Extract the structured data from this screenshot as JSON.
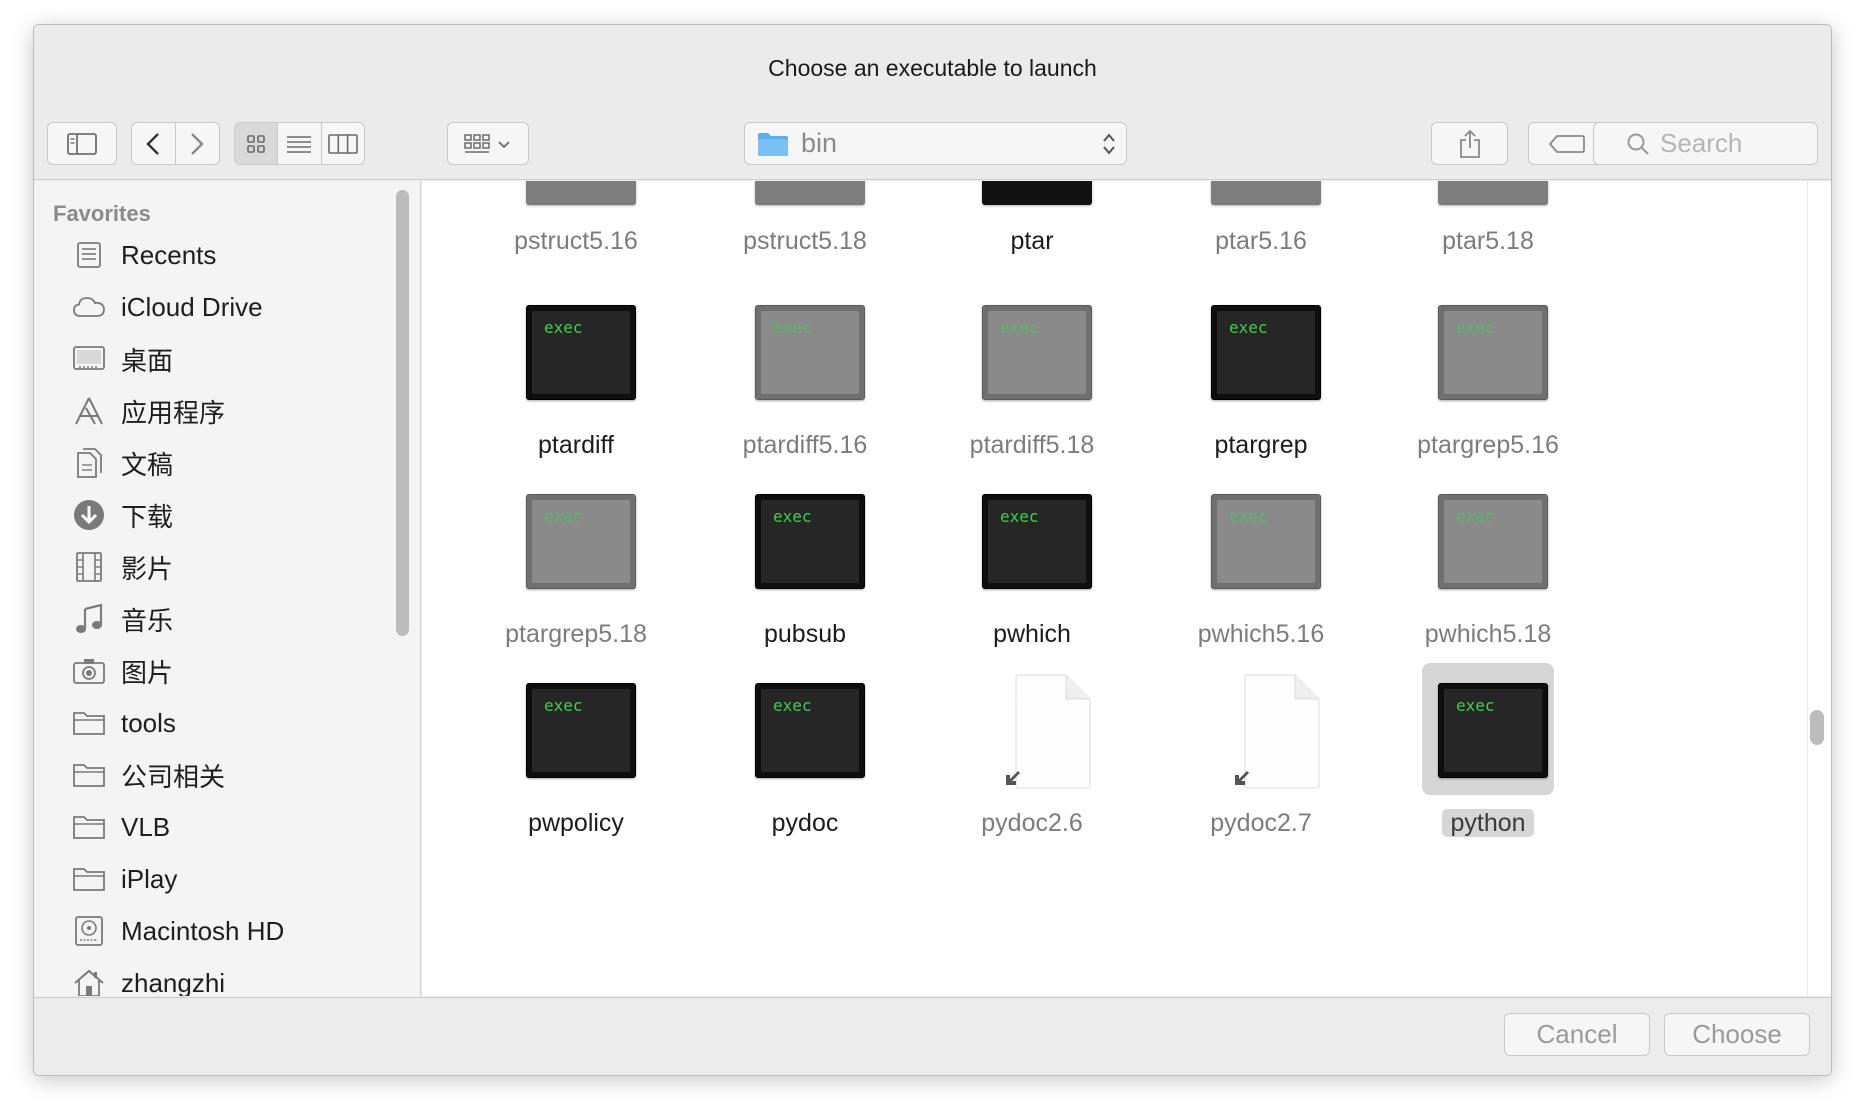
{
  "window": {
    "title": "Choose an executable to launch"
  },
  "toolbar": {
    "path_folder": "bin",
    "search_placeholder": "Search"
  },
  "sidebar": {
    "header": "Favorites",
    "items": [
      {
        "label": "Recents",
        "icon": "recents-icon"
      },
      {
        "label": "iCloud Drive",
        "icon": "cloud-icon"
      },
      {
        "label": "桌面",
        "icon": "desktop-icon"
      },
      {
        "label": "应用程序",
        "icon": "applications-icon"
      },
      {
        "label": "文稿",
        "icon": "documents-icon"
      },
      {
        "label": "下载",
        "icon": "downloads-icon"
      },
      {
        "label": "影片",
        "icon": "movies-icon"
      },
      {
        "label": "音乐",
        "icon": "music-icon"
      },
      {
        "label": "图片",
        "icon": "camera-icon"
      },
      {
        "label": "tools",
        "icon": "folder-icon"
      },
      {
        "label": "公司相关",
        "icon": "folder-icon"
      },
      {
        "label": "VLB",
        "icon": "folder-icon"
      },
      {
        "label": "iPlay",
        "icon": "folder-icon"
      },
      {
        "label": "Macintosh HD",
        "icon": "hard-drive-icon"
      },
      {
        "label": "zhangzhi",
        "icon": "home-icon"
      }
    ]
  },
  "files": {
    "partial_row": [
      {
        "name": "pstruct5.16",
        "kind": "grey"
      },
      {
        "name": "pstruct5.18",
        "kind": "grey"
      },
      {
        "name": "ptar",
        "kind": "dark"
      },
      {
        "name": "ptar5.16",
        "kind": "grey"
      },
      {
        "name": "ptar5.18",
        "kind": "grey"
      }
    ],
    "rows": [
      [
        {
          "name": "ptardiff",
          "kind": "dark"
        },
        {
          "name": "ptardiff5.16",
          "kind": "grey"
        },
        {
          "name": "ptardiff5.18",
          "kind": "grey"
        },
        {
          "name": "ptargrep",
          "kind": "dark"
        },
        {
          "name": "ptargrep5.16",
          "kind": "grey"
        }
      ],
      [
        {
          "name": "ptargrep5.18",
          "kind": "grey"
        },
        {
          "name": "pubsub",
          "kind": "dark"
        },
        {
          "name": "pwhich",
          "kind": "dark"
        },
        {
          "name": "pwhich5.16",
          "kind": "grey"
        },
        {
          "name": "pwhich5.18",
          "kind": "grey"
        }
      ],
      [
        {
          "name": "pwpolicy",
          "kind": "dark"
        },
        {
          "name": "pydoc",
          "kind": "dark"
        },
        {
          "name": "pydoc2.6",
          "kind": "alias"
        },
        {
          "name": "pydoc2.7",
          "kind": "alias"
        },
        {
          "name": "python",
          "kind": "dark",
          "selected": true
        }
      ]
    ],
    "exec_badge": "exec"
  },
  "footer": {
    "cancel_label": "Cancel",
    "choose_label": "Choose"
  }
}
